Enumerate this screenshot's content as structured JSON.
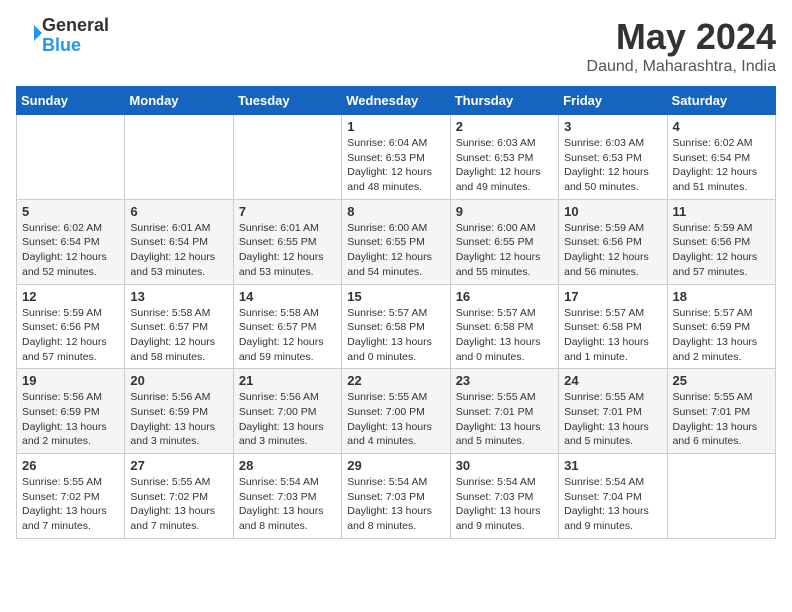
{
  "header": {
    "logo_line1": "General",
    "logo_line2": "Blue",
    "month_title": "May 2024",
    "location": "Daund, Maharashtra, India"
  },
  "days_of_week": [
    "Sunday",
    "Monday",
    "Tuesday",
    "Wednesday",
    "Thursday",
    "Friday",
    "Saturday"
  ],
  "weeks": [
    [
      {
        "day": "",
        "info": ""
      },
      {
        "day": "",
        "info": ""
      },
      {
        "day": "",
        "info": ""
      },
      {
        "day": "1",
        "info": "Sunrise: 6:04 AM\nSunset: 6:53 PM\nDaylight: 12 hours\nand 48 minutes."
      },
      {
        "day": "2",
        "info": "Sunrise: 6:03 AM\nSunset: 6:53 PM\nDaylight: 12 hours\nand 49 minutes."
      },
      {
        "day": "3",
        "info": "Sunrise: 6:03 AM\nSunset: 6:53 PM\nDaylight: 12 hours\nand 50 minutes."
      },
      {
        "day": "4",
        "info": "Sunrise: 6:02 AM\nSunset: 6:54 PM\nDaylight: 12 hours\nand 51 minutes."
      }
    ],
    [
      {
        "day": "5",
        "info": "Sunrise: 6:02 AM\nSunset: 6:54 PM\nDaylight: 12 hours\nand 52 minutes."
      },
      {
        "day": "6",
        "info": "Sunrise: 6:01 AM\nSunset: 6:54 PM\nDaylight: 12 hours\nand 53 minutes."
      },
      {
        "day": "7",
        "info": "Sunrise: 6:01 AM\nSunset: 6:55 PM\nDaylight: 12 hours\nand 53 minutes."
      },
      {
        "day": "8",
        "info": "Sunrise: 6:00 AM\nSunset: 6:55 PM\nDaylight: 12 hours\nand 54 minutes."
      },
      {
        "day": "9",
        "info": "Sunrise: 6:00 AM\nSunset: 6:55 PM\nDaylight: 12 hours\nand 55 minutes."
      },
      {
        "day": "10",
        "info": "Sunrise: 5:59 AM\nSunset: 6:56 PM\nDaylight: 12 hours\nand 56 minutes."
      },
      {
        "day": "11",
        "info": "Sunrise: 5:59 AM\nSunset: 6:56 PM\nDaylight: 12 hours\nand 57 minutes."
      }
    ],
    [
      {
        "day": "12",
        "info": "Sunrise: 5:59 AM\nSunset: 6:56 PM\nDaylight: 12 hours\nand 57 minutes."
      },
      {
        "day": "13",
        "info": "Sunrise: 5:58 AM\nSunset: 6:57 PM\nDaylight: 12 hours\nand 58 minutes."
      },
      {
        "day": "14",
        "info": "Sunrise: 5:58 AM\nSunset: 6:57 PM\nDaylight: 12 hours\nand 59 minutes."
      },
      {
        "day": "15",
        "info": "Sunrise: 5:57 AM\nSunset: 6:58 PM\nDaylight: 13 hours\nand 0 minutes."
      },
      {
        "day": "16",
        "info": "Sunrise: 5:57 AM\nSunset: 6:58 PM\nDaylight: 13 hours\nand 0 minutes."
      },
      {
        "day": "17",
        "info": "Sunrise: 5:57 AM\nSunset: 6:58 PM\nDaylight: 13 hours\nand 1 minute."
      },
      {
        "day": "18",
        "info": "Sunrise: 5:57 AM\nSunset: 6:59 PM\nDaylight: 13 hours\nand 2 minutes."
      }
    ],
    [
      {
        "day": "19",
        "info": "Sunrise: 5:56 AM\nSunset: 6:59 PM\nDaylight: 13 hours\nand 2 minutes."
      },
      {
        "day": "20",
        "info": "Sunrise: 5:56 AM\nSunset: 6:59 PM\nDaylight: 13 hours\nand 3 minutes."
      },
      {
        "day": "21",
        "info": "Sunrise: 5:56 AM\nSunset: 7:00 PM\nDaylight: 13 hours\nand 3 minutes."
      },
      {
        "day": "22",
        "info": "Sunrise: 5:55 AM\nSunset: 7:00 PM\nDaylight: 13 hours\nand 4 minutes."
      },
      {
        "day": "23",
        "info": "Sunrise: 5:55 AM\nSunset: 7:01 PM\nDaylight: 13 hours\nand 5 minutes."
      },
      {
        "day": "24",
        "info": "Sunrise: 5:55 AM\nSunset: 7:01 PM\nDaylight: 13 hours\nand 5 minutes."
      },
      {
        "day": "25",
        "info": "Sunrise: 5:55 AM\nSunset: 7:01 PM\nDaylight: 13 hours\nand 6 minutes."
      }
    ],
    [
      {
        "day": "26",
        "info": "Sunrise: 5:55 AM\nSunset: 7:02 PM\nDaylight: 13 hours\nand 7 minutes."
      },
      {
        "day": "27",
        "info": "Sunrise: 5:55 AM\nSunset: 7:02 PM\nDaylight: 13 hours\nand 7 minutes."
      },
      {
        "day": "28",
        "info": "Sunrise: 5:54 AM\nSunset: 7:03 PM\nDaylight: 13 hours\nand 8 minutes."
      },
      {
        "day": "29",
        "info": "Sunrise: 5:54 AM\nSunset: 7:03 PM\nDaylight: 13 hours\nand 8 minutes."
      },
      {
        "day": "30",
        "info": "Sunrise: 5:54 AM\nSunset: 7:03 PM\nDaylight: 13 hours\nand 9 minutes."
      },
      {
        "day": "31",
        "info": "Sunrise: 5:54 AM\nSunset: 7:04 PM\nDaylight: 13 hours\nand 9 minutes."
      },
      {
        "day": "",
        "info": ""
      }
    ]
  ]
}
